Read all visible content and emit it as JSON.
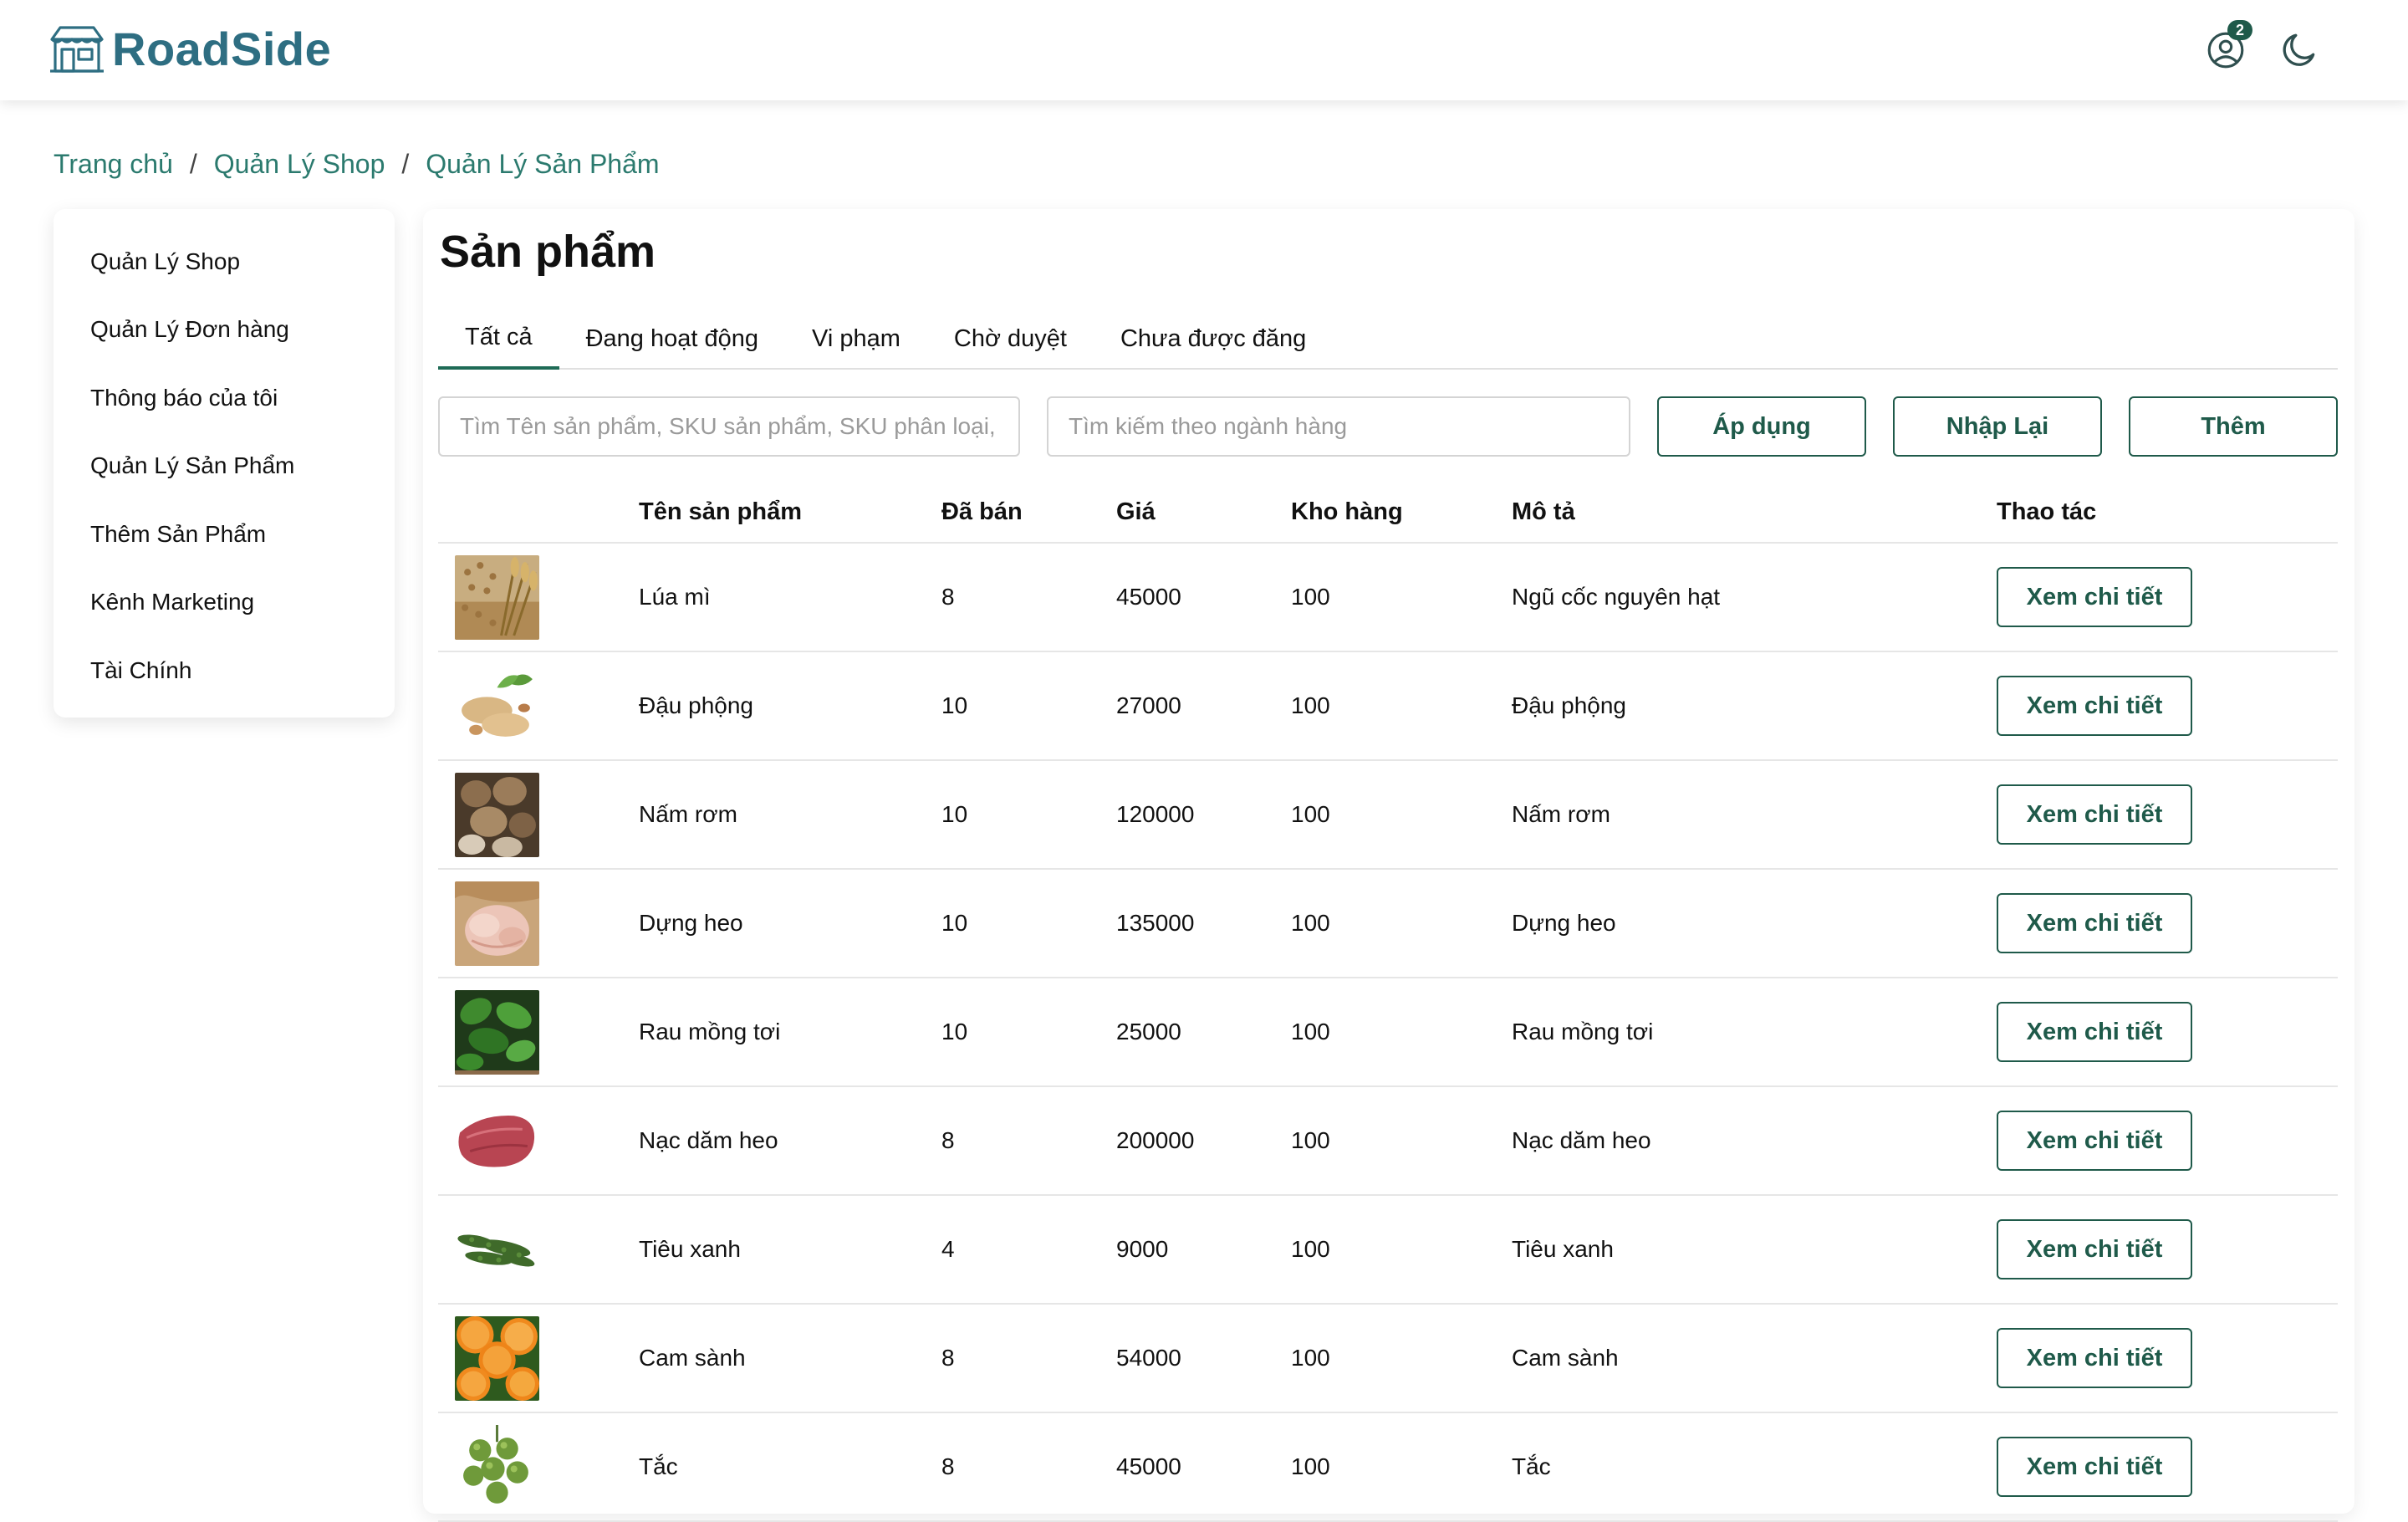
{
  "app": {
    "brand": "RoadSide",
    "brand_color": "#2e6e82",
    "accent_color": "#1f5a4a",
    "notification_count": "2"
  },
  "header": {
    "icons": [
      "storefront-logo-icon",
      "user-account-icon",
      "dark-mode-moon-icon"
    ]
  },
  "breadcrumb": [
    "Trang chủ",
    "Quản Lý Shop",
    "Quản Lý Sản Phẩm"
  ],
  "sidebar": {
    "items": [
      {
        "label": "Quản Lý Shop"
      },
      {
        "label": "Quản Lý Đơn hàng"
      },
      {
        "label": "Thông báo của tôi"
      },
      {
        "label": "Quản Lý Sản Phẩm"
      },
      {
        "label": "Thêm Sản Phẩm"
      },
      {
        "label": "Kênh Marketing"
      },
      {
        "label": "Tài Chính"
      }
    ]
  },
  "main": {
    "title": "Sản phẩm",
    "tabs": [
      {
        "label": "Tất cả",
        "active": true
      },
      {
        "label": "Đang hoạt động",
        "active": false
      },
      {
        "label": "Vi phạm",
        "active": false
      },
      {
        "label": "Chờ duyệt",
        "active": false
      },
      {
        "label": "Chưa được đăng",
        "active": false
      }
    ],
    "filters": {
      "search_placeholder": "Tìm Tên sản phẩm, SKU sản phẩm, SKU phân loại,",
      "category_placeholder": "Tìm kiếm theo ngành hàng",
      "apply_label": "Áp dụng",
      "reset_label": "Nhập Lại",
      "add_label": "Thêm"
    },
    "table": {
      "headers": {
        "name": "Tên sản phẩm",
        "sold": "Đã bán",
        "price": "Giá",
        "stock": "Kho hàng",
        "desc": "Mô tả",
        "action": "Thao tác"
      },
      "action_label": "Xem chi tiết",
      "rows": [
        {
          "image": "wheat-grain-image",
          "name": "Lúa mì",
          "sold": "8",
          "price": "45000",
          "stock": "100",
          "desc": "Ngũ cốc nguyên hạt"
        },
        {
          "image": "peanut-image",
          "name": "Đậu phộng",
          "sold": "10",
          "price": "27000",
          "stock": "100",
          "desc": "Đậu phộng"
        },
        {
          "image": "straw-mushroom-image",
          "name": "Nấm rơm",
          "sold": "10",
          "price": "120000",
          "stock": "100",
          "desc": "Nấm rơm"
        },
        {
          "image": "pork-tripe-image",
          "name": "Dựng heo",
          "sold": "10",
          "price": "135000",
          "stock": "100",
          "desc": "Dựng heo"
        },
        {
          "image": "malabar-spinach-image",
          "name": "Rau mồng tơi",
          "sold": "10",
          "price": "25000",
          "stock": "100",
          "desc": "Rau mồng tơi"
        },
        {
          "image": "pork-tenderloin-image",
          "name": "Nạc dăm heo",
          "sold": "8",
          "price": "200000",
          "stock": "100",
          "desc": "Nạc dăm heo"
        },
        {
          "image": "green-pepper-image",
          "name": "Tiêu xanh",
          "sold": "4",
          "price": "9000",
          "stock": "100",
          "desc": "Tiêu xanh"
        },
        {
          "image": "king-orange-image",
          "name": "Cam sành",
          "sold": "8",
          "price": "54000",
          "stock": "100",
          "desc": "Cam sành"
        },
        {
          "image": "kumquat-image",
          "name": "Tắc",
          "sold": "8",
          "price": "45000",
          "stock": "100",
          "desc": "Tắc"
        }
      ]
    }
  }
}
